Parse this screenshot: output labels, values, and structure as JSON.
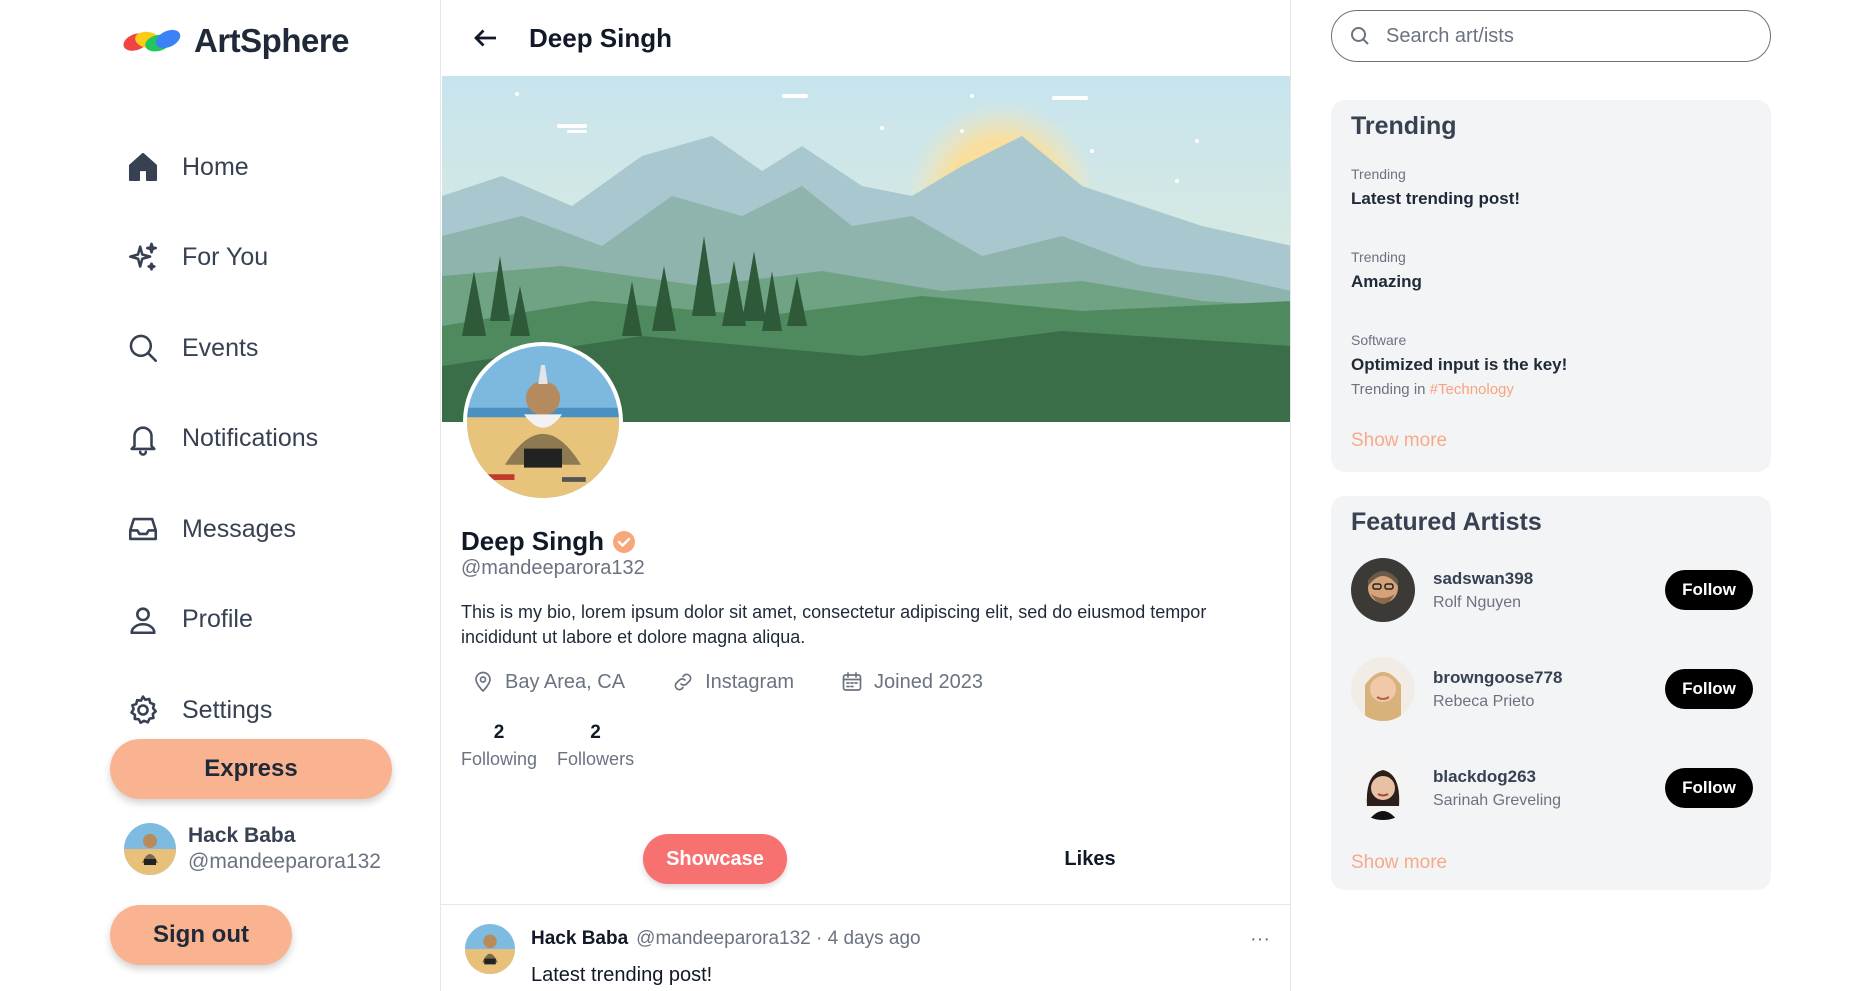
{
  "app": {
    "name": "ArtSphere"
  },
  "nav": [
    {
      "label": "Home",
      "icon": "home-icon"
    },
    {
      "label": "For You",
      "icon": "sparkles-icon"
    },
    {
      "label": "Events",
      "icon": "search-icon"
    },
    {
      "label": "Notifications",
      "icon": "bell-icon"
    },
    {
      "label": "Messages",
      "icon": "inbox-icon"
    },
    {
      "label": "Profile",
      "icon": "user-icon"
    },
    {
      "label": "Settings",
      "icon": "gear-icon"
    }
  ],
  "actions": {
    "express_label": "Express",
    "signout_label": "Sign out"
  },
  "current_user": {
    "name": "Hack Baba",
    "handle": "@mandeeparora132"
  },
  "header": {
    "title": "Deep Singh"
  },
  "profile": {
    "name": "Deep Singh",
    "handle": "@mandeeparora132",
    "bio": "This is my bio, lorem ipsum dolor sit amet, consectetur adipiscing elit, sed do eiusmod tempor incididunt ut labore et dolore magna aliqua.",
    "location": "Bay Area, CA",
    "link": "Instagram",
    "joined": "Joined 2023",
    "following_count": "2",
    "following_label": "Following",
    "followers_count": "2",
    "followers_label": "Followers"
  },
  "tabs": {
    "showcase": "Showcase",
    "likes": "Likes"
  },
  "post": {
    "author": "Hack Baba",
    "meta": "@mandeeparora132 · 4 days ago",
    "more": "···",
    "text": "Latest trending post!"
  },
  "search": {
    "placeholder": "Search art/ists"
  },
  "trending": {
    "title": "Trending",
    "items": [
      {
        "category": "Trending",
        "title": "Latest trending post!"
      },
      {
        "category": "Trending",
        "title": "Amazing"
      },
      {
        "category": "Software",
        "title": "Optimized input is the key!",
        "sub_prefix": "Trending in",
        "tag": "#Technology"
      }
    ],
    "show_more": "Show more"
  },
  "featured": {
    "title": "Featured Artists",
    "artists": [
      {
        "username": "sadswan398",
        "name": "Rolf Nguyen",
        "follow_label": "Follow"
      },
      {
        "username": "browngoose778",
        "name": "Rebeca Prieto",
        "follow_label": "Follow"
      },
      {
        "username": "blackdog263",
        "name": "Sarinah Greveling",
        "follow_label": "Follow"
      }
    ],
    "show_more": "Show more"
  },
  "colors": {
    "accent_peach": "#f9b391",
    "showcase_red": "#f87171",
    "link_peach": "#f9a98a",
    "card_bg": "#f3f4f6"
  }
}
